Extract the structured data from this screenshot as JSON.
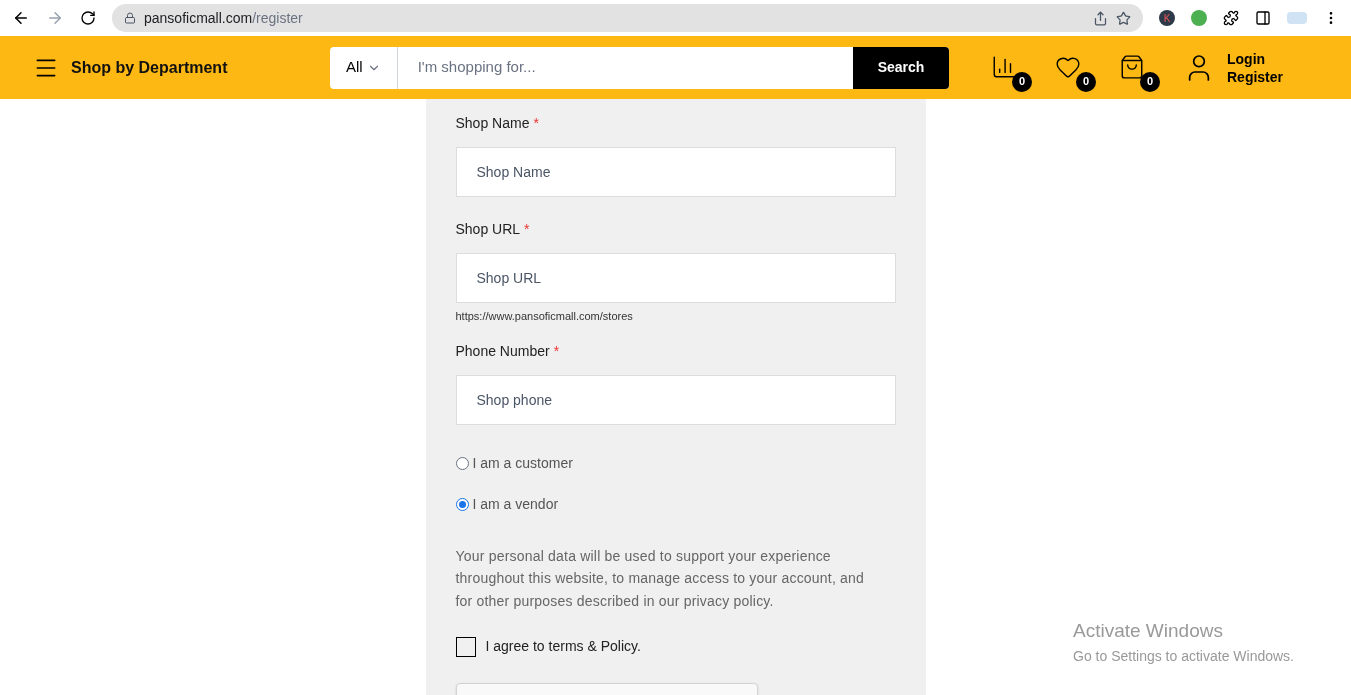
{
  "browser": {
    "url_host": "pansoficmall.com",
    "url_path": "/register",
    "extension_letter": "K"
  },
  "header": {
    "department": "Shop by Department",
    "category": "All",
    "search_placeholder": "I'm shopping for...",
    "search_button": "Search",
    "counters": [
      {
        "kind": "compare",
        "count": "0"
      },
      {
        "kind": "wishlist",
        "count": "0"
      },
      {
        "kind": "cart",
        "count": "0"
      }
    ],
    "account": [
      "Login",
      "Register"
    ]
  },
  "form": {
    "fields": [
      {
        "label": "Shop Name",
        "required_mark": "*",
        "placeholder": "Shop Name"
      },
      {
        "label": "Shop URL",
        "required_mark": "*",
        "placeholder": "Shop URL",
        "hint": "https://www.pansoficmall.com/stores"
      },
      {
        "label": "Phone Number",
        "required_mark": "*",
        "placeholder": "Shop phone"
      }
    ],
    "roles": [
      {
        "label": "I am a customer",
        "selected": false
      },
      {
        "label": "I am a vendor",
        "selected": true
      }
    ],
    "privacy": "Your personal data will be used to support your experience throughout this website, to manage access to your account, and for other purposes described in our privacy policy.",
    "agree": {
      "label": "I agree to terms & Policy.",
      "checked": false
    }
  },
  "os_notice": {
    "title": "Activate Windows",
    "subtitle": "Go to Settings to activate Windows."
  }
}
